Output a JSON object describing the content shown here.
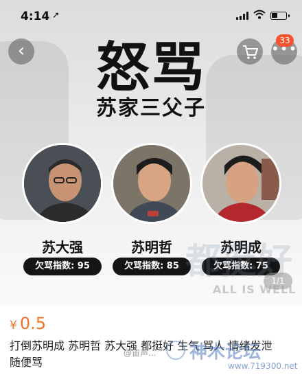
{
  "status": {
    "time": "4:14",
    "location_arrow": "➚"
  },
  "nav": {
    "back_glyph": "‹",
    "more_glyph": "•••",
    "notification_count": "33"
  },
  "poster": {
    "title": "怒骂",
    "subtitle": "苏家三父子",
    "people": [
      {
        "name": "苏大强",
        "index_label": "欠骂指数: 95"
      },
      {
        "name": "苏明哲",
        "index_label": "欠骂指数: 85"
      },
      {
        "name": "苏明成",
        "index_label": "欠骂指数: 75"
      }
    ],
    "watermark_en": "ALL IS WELL",
    "pager": "1/1"
  },
  "product": {
    "currency": "¥",
    "price": "0.5",
    "description": "打倒苏明成 苏明哲 苏大强 都挺好 生气 骂人 情绪发泄 随便骂"
  },
  "overlay": {
    "weibo_handle": "@宙声...",
    "forum_name": "神木论坛",
    "forum_url": "www.719300.net"
  },
  "colors": {
    "accent": "#f3702a",
    "badge": "#f5522d",
    "index_bg": "#151515"
  }
}
